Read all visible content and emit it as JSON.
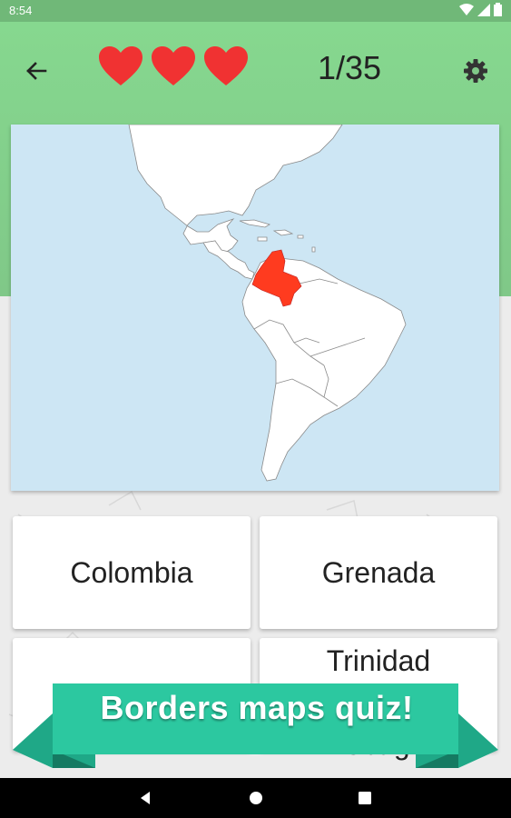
{
  "status_bar": {
    "time": "8:54",
    "icons": [
      "wifi-icon",
      "signal-icon",
      "battery-icon"
    ]
  },
  "header": {
    "back_icon": "arrow-left-icon",
    "lives": 3,
    "hearts": [
      "heart-icon",
      "heart-icon",
      "heart-icon"
    ],
    "progress": "1/35",
    "settings_icon": "gear-icon"
  },
  "map": {
    "highlight_color": "#ff3b1f",
    "water_color": "#cde6f4",
    "land_color": "#ffffff"
  },
  "answers": [
    {
      "label": "Colombia"
    },
    {
      "label": "Grenada"
    },
    {
      "label": ""
    },
    {
      "label_line1": "Trinidad",
      "label_line3": "Tobago"
    }
  ],
  "banner": {
    "text": "Borders maps quiz!",
    "color": "#2cc8a0"
  },
  "nav_bar": {
    "icons": [
      "back-triangle-icon",
      "home-circle-icon",
      "recents-square-icon"
    ]
  },
  "colors": {
    "header_green": "#86d88f",
    "heart_red": "#f03232"
  }
}
